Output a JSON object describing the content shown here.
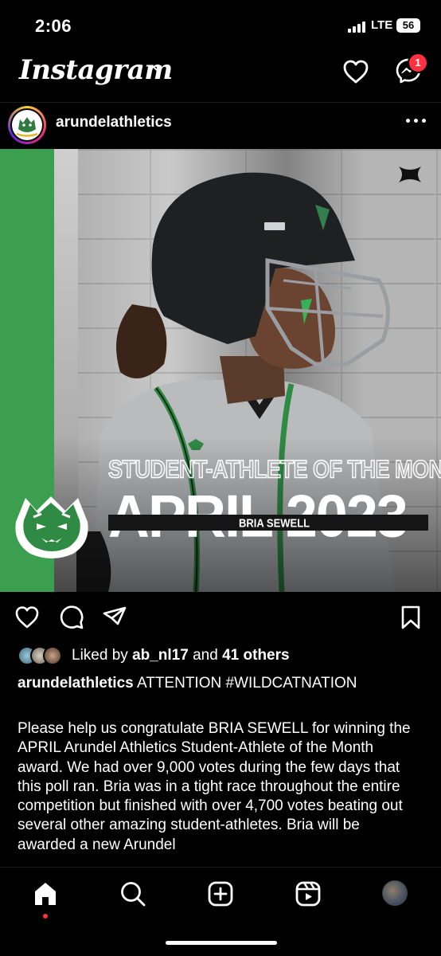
{
  "status_bar": {
    "time": "2:06",
    "network": "LTE",
    "battery": "56"
  },
  "header": {
    "brand": "Instagram",
    "icons": [
      "chevron-down-icon",
      "heart-icon",
      "messenger-icon"
    ],
    "messages_badge": "1"
  },
  "post": {
    "username": "arundelathletics",
    "image": {
      "headline_small": "STUDENT-ATHLETE OF THE MONTH",
      "headline_large": "APRIL 2023",
      "athlete_name": "BRIA SEWELL",
      "accent_color": "#3c9e4f"
    },
    "actions": [
      "heart-icon",
      "comment-icon",
      "share-icon",
      "bookmark-icon"
    ],
    "likes": {
      "prefix": "Liked by",
      "user": "ab_nl17",
      "middle": "and",
      "others": "41 others"
    },
    "caption": {
      "username": "arundelathletics",
      "headline": "ATTENTION #WILDCATNATION",
      "body": "Please help us congratulate BRIA SEWELL for winning the APRIL Arundel Athletics Student-Athlete of the Month award. We had over 9,000 votes during the few days that this poll ran. Bria was in a tight race throughout the entire competition but finished with over 4,700 votes beating out several other amazing student-athletes. Bria will be awarded a new Arundel"
    }
  },
  "bottom_nav": {
    "items": [
      "home-icon",
      "search-icon",
      "create-icon",
      "reels-icon",
      "profile-avatar"
    ],
    "notification_color": "#ff3040"
  }
}
